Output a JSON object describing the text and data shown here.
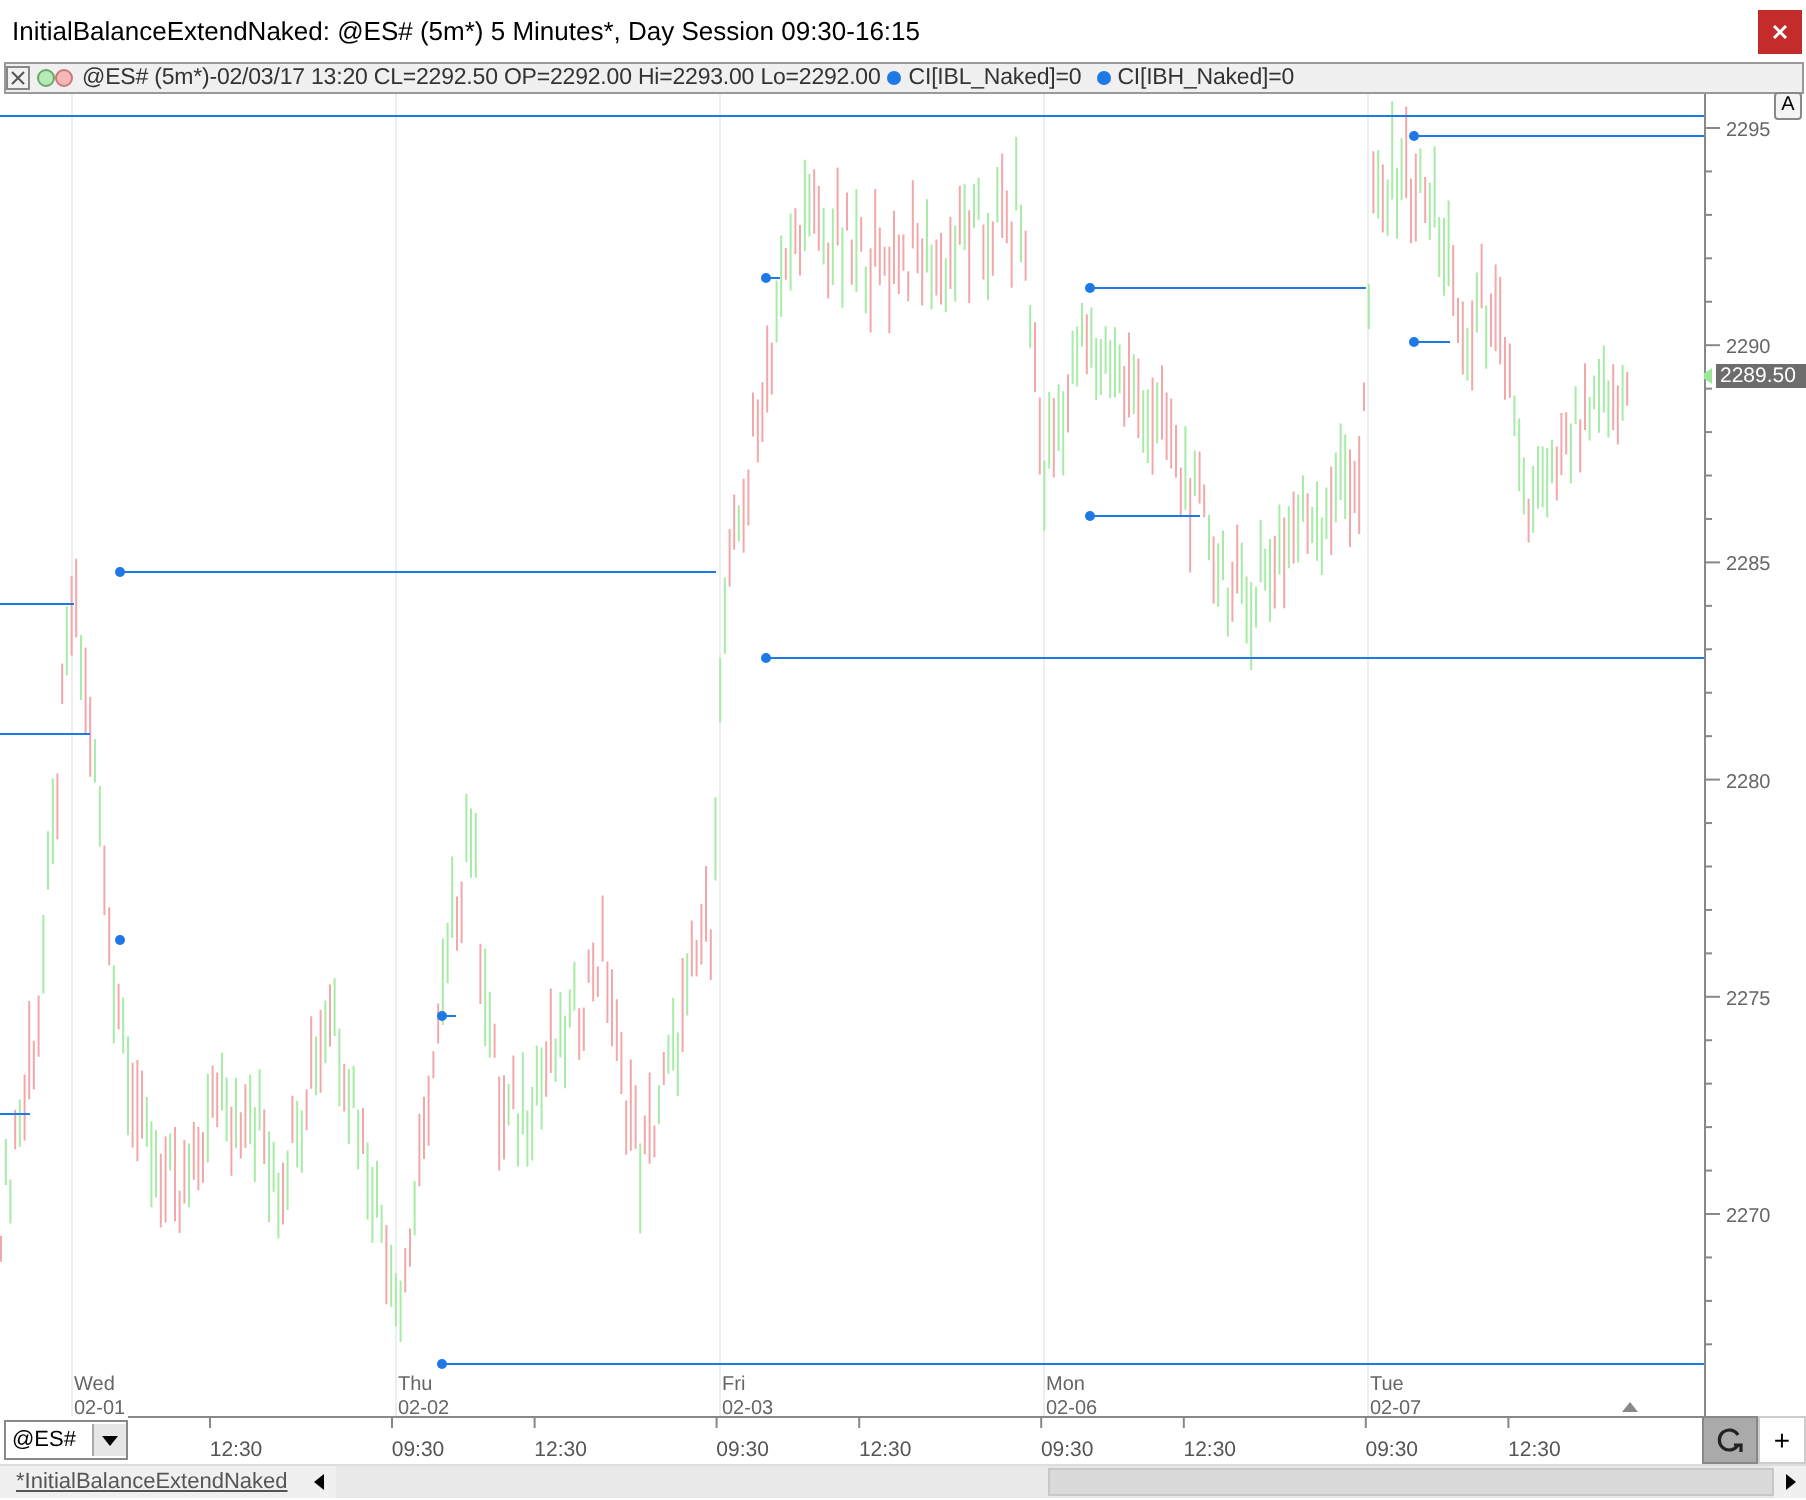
{
  "window": {
    "title": "InitialBalanceExtendNaked: @ES# (5m*) 5 Minutes*, Day Session 09:30-16:15"
  },
  "legend": {
    "text": "@ES# (5m*)-02/03/17 13:20 CL=2292.50 OP=2292.00 Hi=2293.00 Lo=2292.00",
    "indicators": [
      {
        "label": "CI[IBL_Naked]=0"
      },
      {
        "label": "CI[IBH_Naked]=0"
      }
    ]
  },
  "chart": {
    "scale_button": "A",
    "last_price": "2289.50",
    "y_labels": [
      "2295",
      "2290",
      "2285",
      "2280",
      "2275",
      "2270"
    ],
    "days": [
      {
        "weekday": "Wed",
        "date": "02-01"
      },
      {
        "weekday": "Thu",
        "date": "02-02"
      },
      {
        "weekday": "Fri",
        "date": "02-03"
      },
      {
        "weekday": "Mon",
        "date": "02-06"
      },
      {
        "weekday": "Tue",
        "date": "02-07"
      }
    ]
  },
  "time_axis": {
    "symbol": "@ES#",
    "labels": [
      "12:30",
      "09:30",
      "12:30",
      "09:30",
      "12:30",
      "09:30",
      "12:30",
      "09:30",
      "12:30"
    ],
    "add_button": "+"
  },
  "sheet_tab": {
    "label": "*InitialBalanceExtendNaked"
  }
}
